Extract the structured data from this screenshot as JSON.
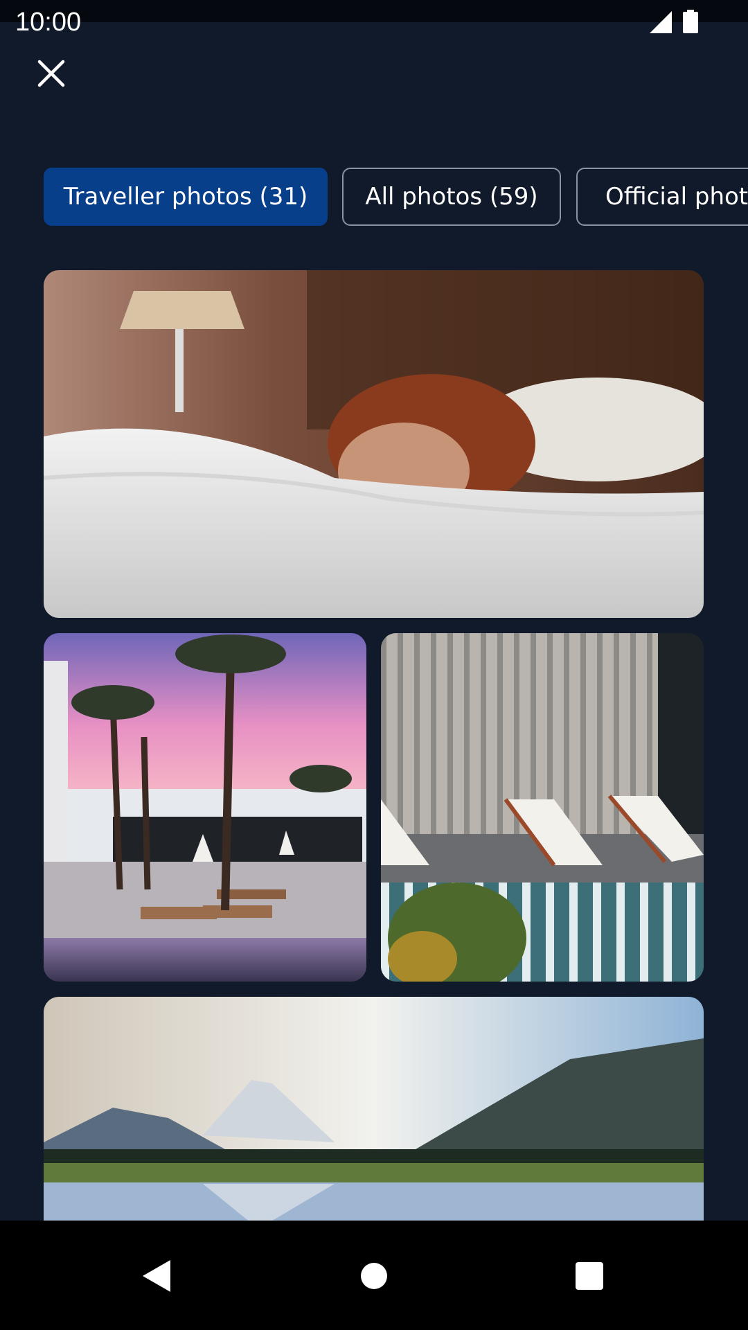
{
  "status_bar": {
    "time": "10:00",
    "icons": [
      "signal-icon",
      "battery-icon"
    ]
  },
  "header": {
    "close_icon": "close-icon"
  },
  "tabs": [
    {
      "label": "Traveller photos (31)",
      "selected": true
    },
    {
      "label": "All photos (59)",
      "selected": false
    },
    {
      "label": "Official photos",
      "selected": false
    }
  ],
  "photos": [
    {
      "subject": "person-in-bed"
    },
    {
      "subject": "palm-pool-sunset"
    },
    {
      "subject": "pool-loungers"
    },
    {
      "subject": "mountain-lake"
    }
  ],
  "nav_bar": {
    "icons": [
      "back-icon",
      "home-icon",
      "recents-icon"
    ]
  },
  "colors": {
    "background": "#111a2b",
    "chip_active": "#073f8a",
    "chip_border": "#8b93a3",
    "text": "#ffffff"
  }
}
